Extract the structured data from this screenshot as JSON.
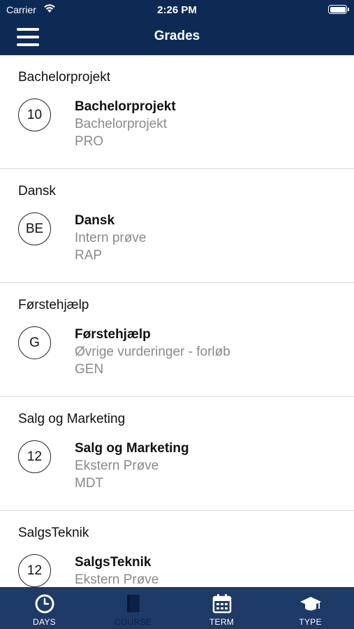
{
  "status_bar": {
    "carrier": "Carrier",
    "time": "2:26 PM"
  },
  "nav": {
    "title": "Grades",
    "menu_icon": "hamburger-menu-icon"
  },
  "grades": [
    {
      "section": "Bachelorprojekt",
      "grade": "10",
      "name": "Bachelorprojekt",
      "type": "Bachelorprojekt",
      "code": "PRO"
    },
    {
      "section": "Dansk",
      "grade": "BE",
      "name": "Dansk",
      "type": "Intern prøve",
      "code": "RAP"
    },
    {
      "section": "Førstehjælp",
      "grade": "G",
      "name": "Førstehjælp",
      "type": "Øvrige vurderinger - forløb",
      "code": "GEN"
    },
    {
      "section": "Salg og Marketing",
      "grade": "12",
      "name": "Salg og Marketing",
      "type": "Ekstern Prøve",
      "code": "MDT"
    },
    {
      "section": "SalgsTeknik",
      "grade": "12",
      "name": "SalgsTeknik",
      "type": "Ekstern Prøve",
      "code": ""
    }
  ],
  "tabs": [
    {
      "label": "DAYS",
      "icon": "clock-icon",
      "active": true
    },
    {
      "label": "COURSE",
      "icon": "book-icon",
      "active": false
    },
    {
      "label": "TERM",
      "icon": "calendar-icon",
      "active": true
    },
    {
      "label": "TYPE",
      "icon": "graduation-cap-icon",
      "active": true
    }
  ],
  "colors": {
    "header": "#0d2a55",
    "tabbar": "#1e3a66",
    "inactive_tab": "#0d2145"
  }
}
